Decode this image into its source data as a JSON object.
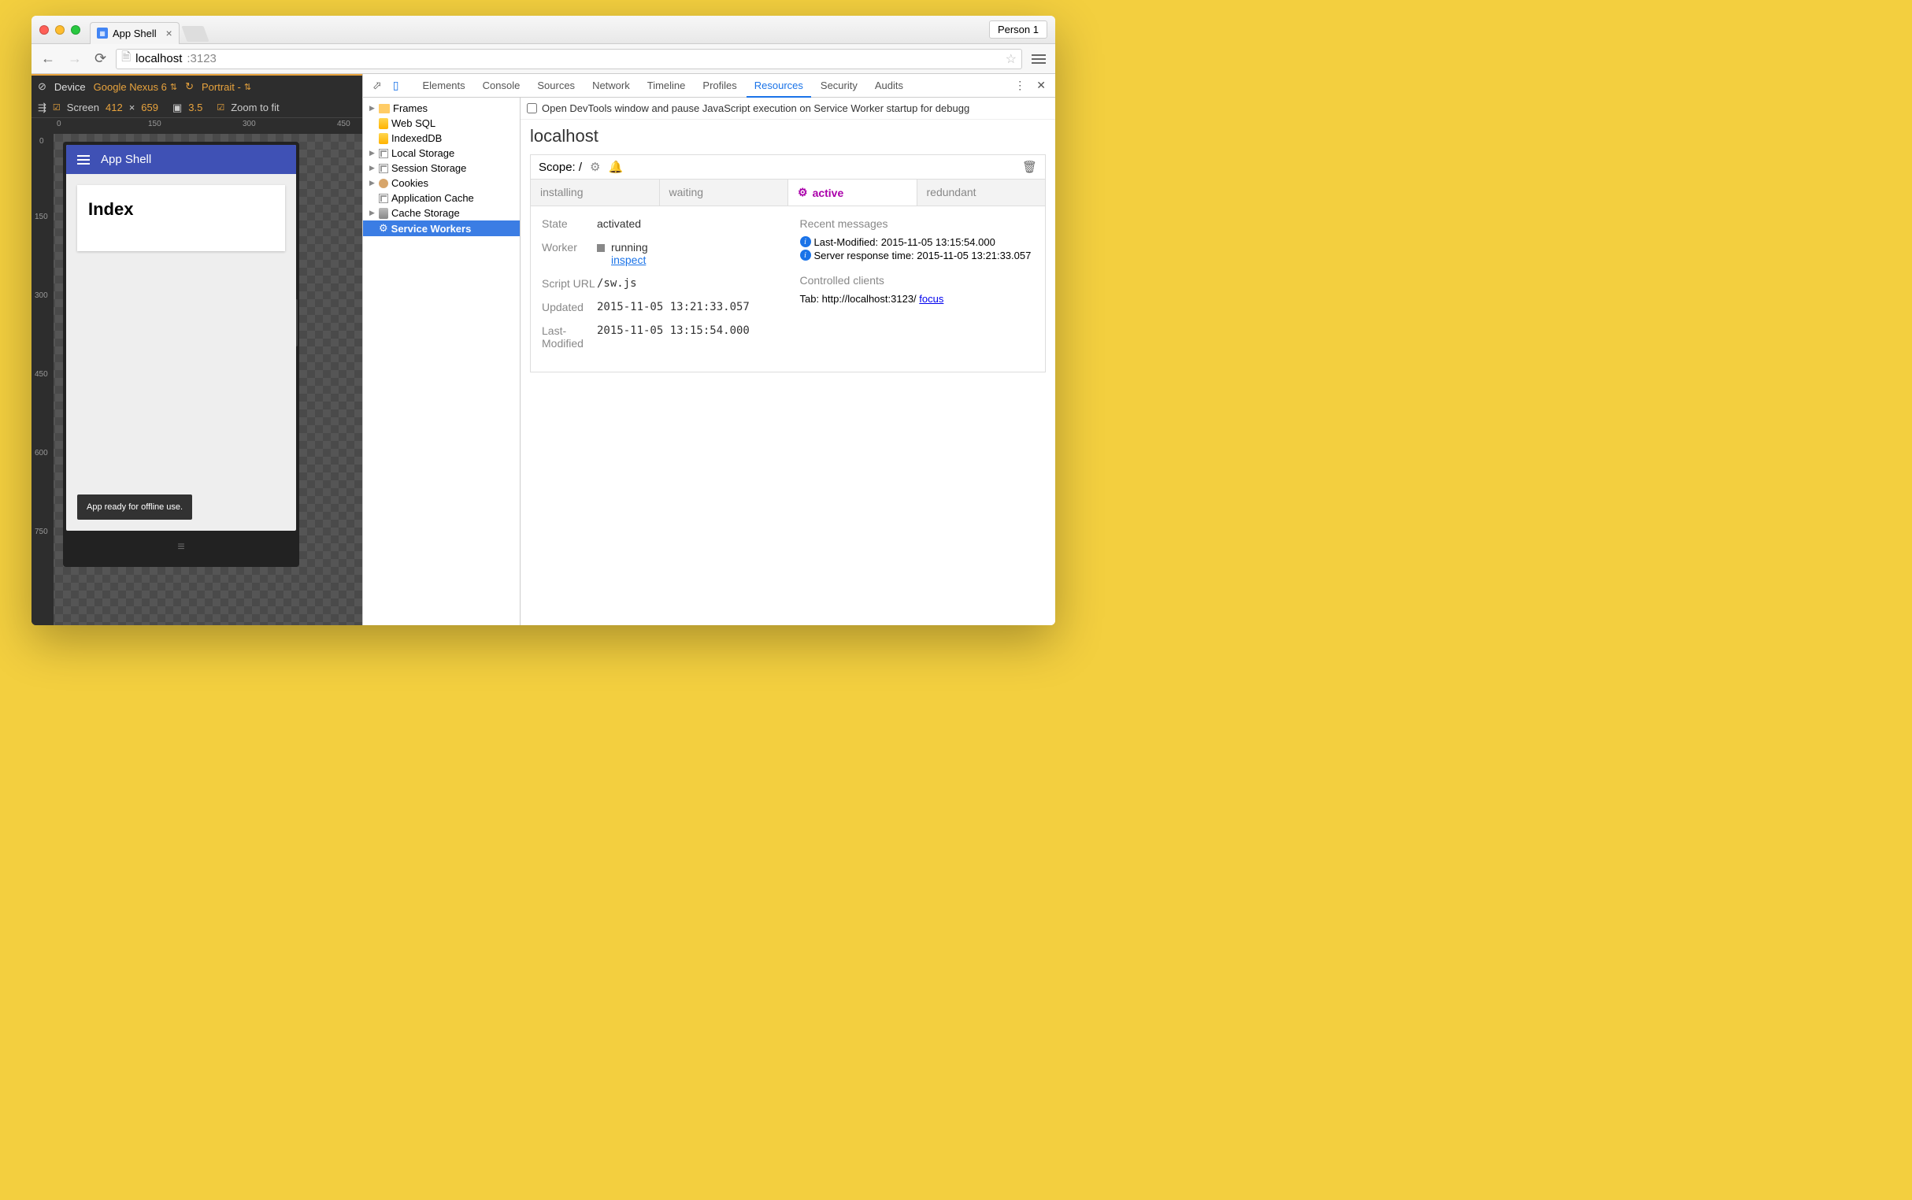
{
  "browser": {
    "tab_title": "App Shell",
    "person": "Person 1",
    "url_host": "localhost",
    "url_port": ":3123"
  },
  "device_toolbar": {
    "device_label": "Device",
    "device_value": "Google Nexus 6",
    "orientation": "Portrait -",
    "screen_label": "Screen",
    "width": "412",
    "times": "×",
    "height": "659",
    "dpr": "3.5",
    "zoom": "Zoom to fit"
  },
  "ruler_h": [
    "0",
    "150",
    "300",
    "450"
  ],
  "ruler_v": [
    "0",
    "150",
    "300",
    "450",
    "600",
    "750"
  ],
  "app": {
    "title": "App Shell",
    "card_heading": "Index",
    "toast": "App ready for offline use."
  },
  "devtools": {
    "tabs": [
      "Elements",
      "Console",
      "Sources",
      "Network",
      "Timeline",
      "Profiles",
      "Resources",
      "Security",
      "Audits"
    ],
    "active_tab": "Resources",
    "banner": "Open DevTools window and pause JavaScript execution on Service Worker startup for debugg",
    "sidebar": [
      {
        "label": "Frames",
        "icon": "folder",
        "caret": true
      },
      {
        "label": "Web SQL",
        "icon": "websql"
      },
      {
        "label": "IndexedDB",
        "icon": "idx"
      },
      {
        "label": "Local Storage",
        "icon": "grid",
        "caret": true
      },
      {
        "label": "Session Storage",
        "icon": "grid",
        "caret": true
      },
      {
        "label": "Cookies",
        "icon": "cookie",
        "caret": true
      },
      {
        "label": "Application Cache",
        "icon": "grid"
      },
      {
        "label": "Cache Storage",
        "icon": "cache",
        "caret": true
      },
      {
        "label": "Service Workers",
        "icon": "gear",
        "selected": true
      }
    ],
    "main": {
      "host": "localhost",
      "scope_label": "Scope: /",
      "sw_tabs": [
        "installing",
        "waiting",
        "active",
        "redundant"
      ],
      "sw_active": "active",
      "state_label": "State",
      "state_value": "activated",
      "worker_label": "Worker",
      "worker_status": "running",
      "worker_inspect": "inspect",
      "script_label": "Script URL",
      "script_value": "/sw.js",
      "updated_label": "Updated",
      "updated_value": "2015-11-05 13:21:33.057",
      "lastmod_label": "Last-Modified",
      "lastmod_value": "2015-11-05 13:15:54.000",
      "recent_heading": "Recent messages",
      "msg1": "Last-Modified: 2015-11-05 13:15:54.000",
      "msg2": "Server response time: 2015-11-05 13:21:33.057",
      "clients_heading": "Controlled clients",
      "client_prefix": "Tab: http://localhost:3123/ ",
      "client_link": "focus"
    }
  }
}
